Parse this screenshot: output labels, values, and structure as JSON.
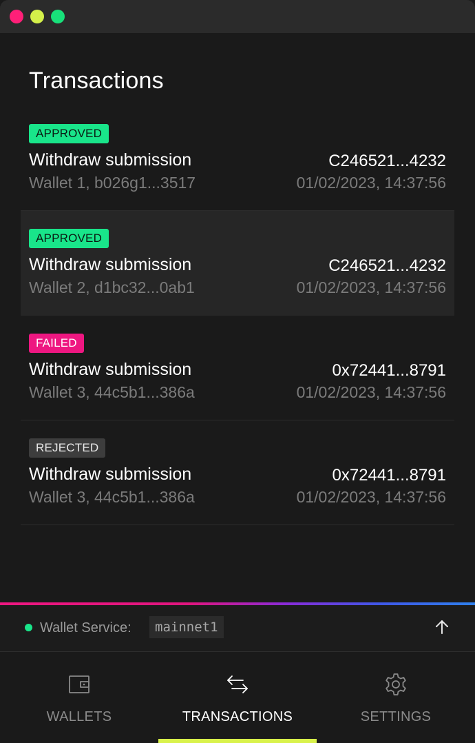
{
  "colors": {
    "close": "#ff1f78",
    "minimize": "#d4f04a",
    "zoom": "#18e07a",
    "approved": "#19e58a",
    "failed": "#ee1781",
    "rejected": "#3d3d3d",
    "status_online": "#19e58a",
    "active_tab": "#d9f24b"
  },
  "page": {
    "title": "Transactions"
  },
  "transactions": [
    {
      "status": "APPROVED",
      "title": "Withdraw submission",
      "wallet": "Wallet 1, b026g1...3517",
      "id": "C246521...4232",
      "time": "01/02/2023, 14:37:56"
    },
    {
      "status": "APPROVED",
      "title": "Withdraw submission",
      "wallet": "Wallet 2, d1bc32...0ab1",
      "id": "C246521...4232",
      "time": "01/02/2023, 14:37:56"
    },
    {
      "status": "FAILED",
      "title": "Withdraw submission",
      "wallet": "Wallet 3, 44c5b1...386a",
      "id": "0x72441...8791",
      "time": "01/02/2023, 14:37:56"
    },
    {
      "status": "REJECTED",
      "title": "Withdraw submission",
      "wallet": "Wallet 3, 44c5b1...386a",
      "id": "0x72441...8791",
      "time": "01/02/2023, 14:37:56"
    }
  ],
  "status_bar": {
    "label": "Wallet Service:",
    "network": "mainnet1",
    "expand_icon": "arrow-up-icon"
  },
  "tabs": [
    {
      "label": "WALLETS",
      "icon": "wallet-icon",
      "active": false
    },
    {
      "label": "TRANSACTIONS",
      "icon": "transfer-arrows-icon",
      "active": true
    },
    {
      "label": "SETTINGS",
      "icon": "gear-icon",
      "active": false
    }
  ]
}
